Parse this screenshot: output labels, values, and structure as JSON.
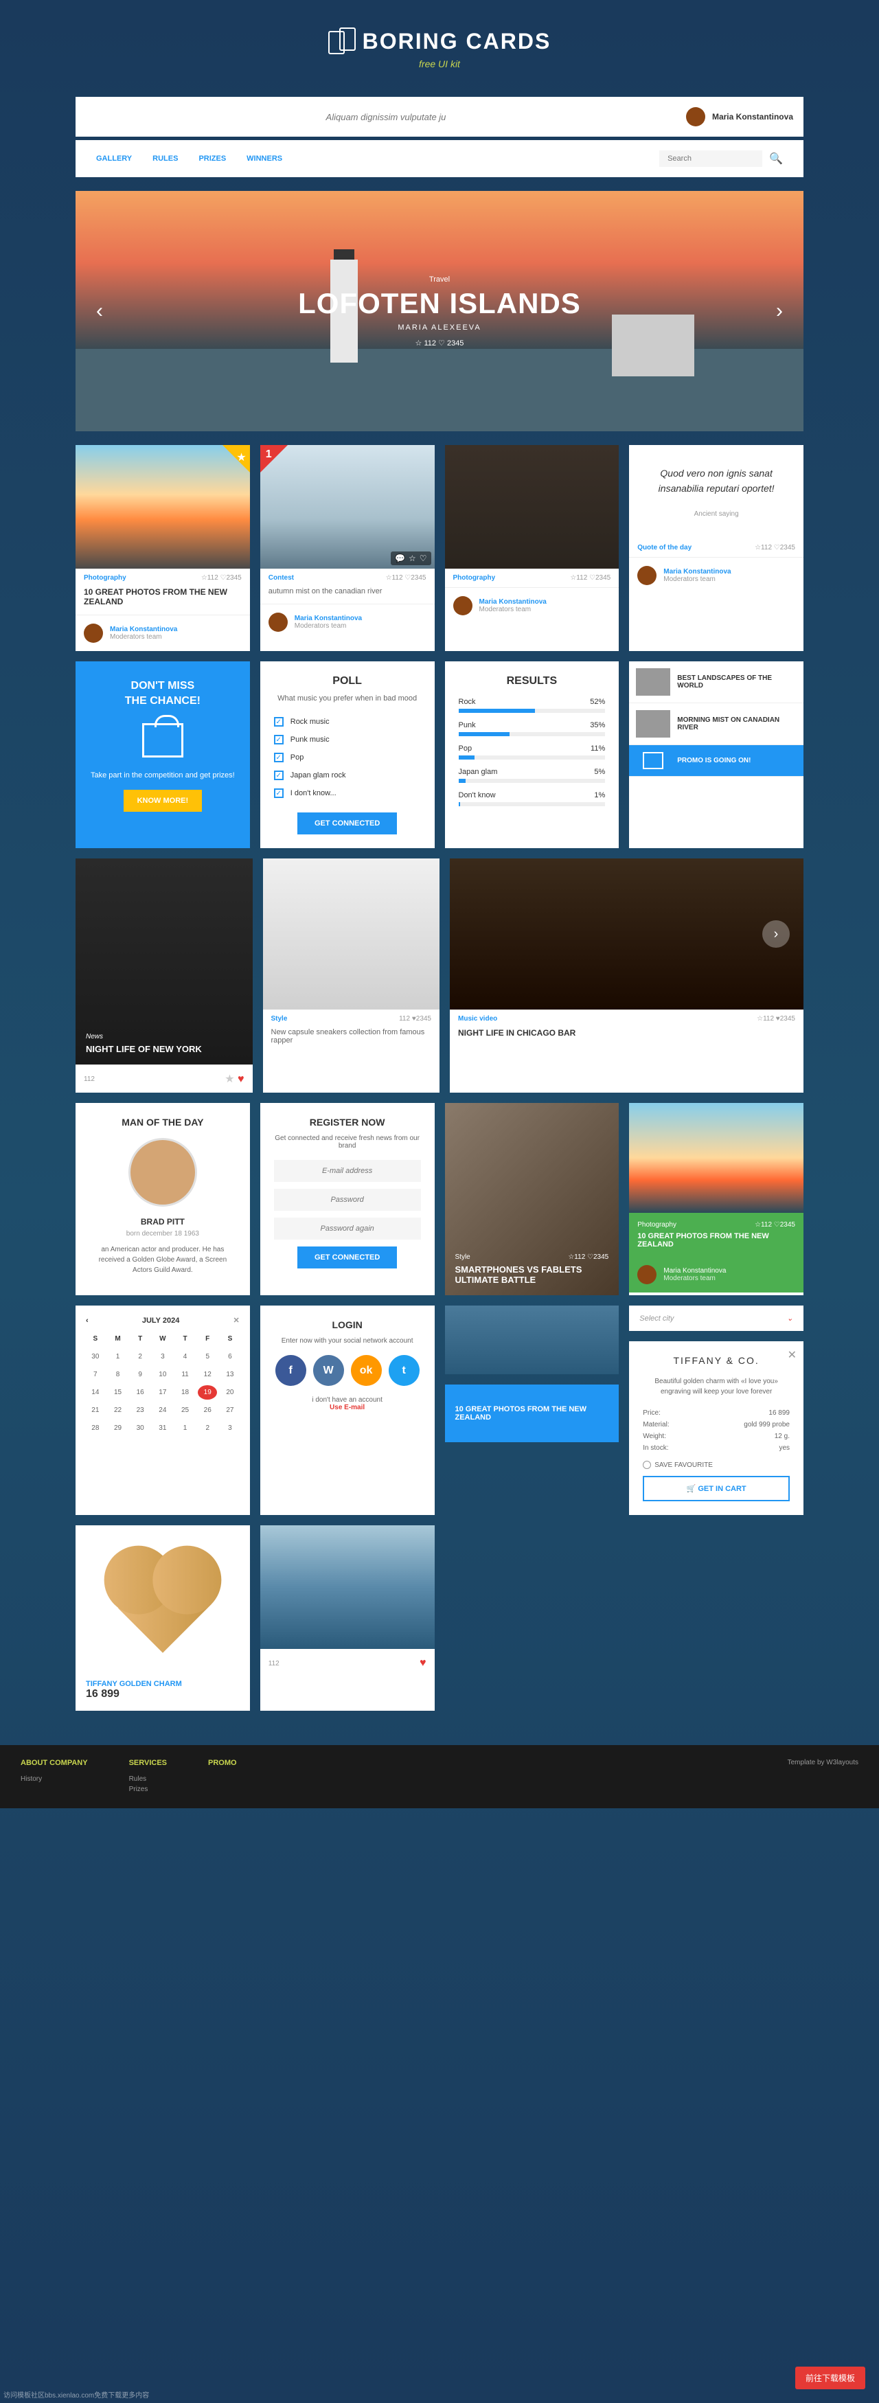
{
  "brand": {
    "name": "BORING CARDS",
    "tagline": "free UI kit"
  },
  "search": {
    "placeholder": "Aliquam dignissim vulputate ju"
  },
  "user": {
    "name": "Maria Konstantinova"
  },
  "nav": {
    "links": [
      "GALLERY",
      "RULES",
      "PRIZES",
      "WINNERS"
    ],
    "search_placeholder": "Search"
  },
  "hero": {
    "category": "Travel",
    "title": "LOFOTEN ISLANDS",
    "author": "MARIA ALEXEEVA",
    "stats": "☆ 112  ♡ 2345"
  },
  "cards": {
    "photo1": {
      "category": "Photography",
      "stats": "☆112  ♡2345",
      "title": "10 GREAT PHOTOS FROM THE NEW ZEALAND",
      "author": "Maria Konstantinova",
      "role": "Moderators team"
    },
    "contest": {
      "category": "Contest",
      "stats": "☆112  ♡2345",
      "title": "autumn mist on the canadian river",
      "author": "Maria Konstantinova",
      "role": "Moderators team"
    },
    "photo2": {
      "category": "Photography",
      "stats": "☆112  ♡2345",
      "author": "Maria Konstantinova",
      "role": "Moderators team"
    },
    "quote": {
      "category": "Quote of the day",
      "stats": "☆112  ♡2345",
      "text": "Quod vero non ignis sanat insanabilia reputari oportet!",
      "author": "Ancient saying",
      "author_name": "Maria Konstantinova",
      "role": "Moderators team"
    }
  },
  "promo": {
    "title1": "DON'T MISS",
    "title2": "THE CHANCE!",
    "text": "Take part in the competition and get prizes!",
    "button": "KNOW MORE!"
  },
  "poll": {
    "title": "POLL",
    "question": "What music you prefer when in bad mood",
    "options": [
      "Rock music",
      "Punk music",
      "Pop",
      "Japan glam rock",
      "I don't know..."
    ],
    "button": "GET CONNECTED"
  },
  "results": {
    "title": "RESULTS",
    "items": [
      {
        "label": "Rock",
        "value": "52%",
        "pct": 52
      },
      {
        "label": "Punk",
        "value": "35%",
        "pct": 35
      },
      {
        "label": "Pop",
        "value": "11%",
        "pct": 11
      },
      {
        "label": "Japan glam",
        "value": "5%",
        "pct": 5
      },
      {
        "label": "Don't know",
        "value": "1%",
        "pct": 1
      }
    ]
  },
  "sidelist": [
    "BEST LANDSCAPES OF THE WORLD",
    "MORNING MIST ON CANADIAN RIVER",
    "PROMO IS GOING ON!"
  ],
  "news": {
    "category": "News",
    "title": "NIGHT LIFE OF NEW YORK",
    "views": "112"
  },
  "style": {
    "category": "Style",
    "stats": "112  ♥2345",
    "title": "New capsule sneakers collection from famous rapper"
  },
  "music": {
    "category": "Music video",
    "stats": "☆112  ♥2345",
    "title": "NIGHT LIFE IN CHICAGO BAR"
  },
  "man": {
    "title": "MAN OF THE DAY",
    "name": "BRAD PITT",
    "born": "born december 18 1963",
    "desc": "an American actor and producer. He has received a Golden Globe Award, a Screen Actors Guild Award."
  },
  "register": {
    "title": "REGISTER NOW",
    "desc": "Get connected and receive fresh news from our brand",
    "email": "E-mail address",
    "pwd": "Password",
    "pwd2": "Password again",
    "button": "GET CONNECTED"
  },
  "phone": {
    "category": "Style",
    "stats": "☆112  ♡2345",
    "title": "SMARTPHONES VS FABLETS ULTIMATE BATTLE"
  },
  "green": {
    "category": "Photography",
    "stats": "☆112  ♡2345",
    "title": "10 GREAT PHOTOS FROM THE NEW ZEALAND",
    "author": "Maria Konstantinova",
    "role": "Moderators team"
  },
  "calendar": {
    "month": "JULY 2024",
    "days": [
      "S",
      "M",
      "T",
      "W",
      "T",
      "F",
      "S"
    ],
    "today": 19
  },
  "login": {
    "title": "LOGIN",
    "desc": "Enter now with your social network account",
    "no_account": "i don't have an account",
    "use_email": "Use E-mail"
  },
  "bluecard": {
    "title": "10 GREAT PHOTOS FROM THE NEW ZEALAND"
  },
  "select": {
    "label": "Select city"
  },
  "tiffany": {
    "logo": "TIFFANY & CO.",
    "desc": "Beautiful golden charm with «I love you» engraving will keep your love forever",
    "rows": [
      {
        "k": "Price:",
        "v": "16 899"
      },
      {
        "k": "Material:",
        "v": "gold 999 probe"
      },
      {
        "k": "Weight:",
        "v": "12 g."
      },
      {
        "k": "In stock:",
        "v": "yes"
      }
    ],
    "save": "SAVE FAVOURITE",
    "button": "🛒 GET IN CART"
  },
  "charm": {
    "name": "TIFFANY GOLDEN CHARM",
    "price": "16 899"
  },
  "waves": {
    "views": "112"
  },
  "footer": {
    "cols": [
      {
        "title": "ABOUT COMPANY",
        "items": [
          "History"
        ]
      },
      {
        "title": "SERVICES",
        "items": [
          "Rules",
          "Prizes"
        ]
      },
      {
        "title": "PROMO",
        "items": []
      }
    ],
    "template": "Template by W3layouts"
  },
  "download": "前往下载模板",
  "watermark": "访问模板社区bbs.xienlao.com免费下载更多内容"
}
